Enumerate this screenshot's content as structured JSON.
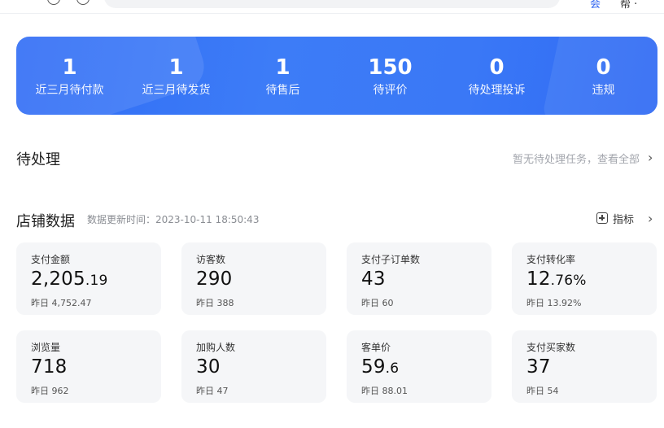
{
  "topbar": {
    "link_text": "会",
    "link_text2": "帮 ·"
  },
  "summary": [
    {
      "value": "1",
      "label": "近三月待付款"
    },
    {
      "value": "1",
      "label": "近三月待发货"
    },
    {
      "value": "1",
      "label": "待售后"
    },
    {
      "value": "150",
      "label": "待评价"
    },
    {
      "value": "0",
      "label": "待处理投诉"
    },
    {
      "value": "0",
      "label": "违规"
    }
  ],
  "pending": {
    "title": "待处理",
    "hint": "暂无待处理任务，查看全部"
  },
  "shop": {
    "title": "店铺数据",
    "update_time": "数据更新时间：2023-10-11 18:50:43",
    "metrics_label": "指标",
    "cards": [
      {
        "title": "支付金额",
        "int": "2,205",
        "dec": ".19",
        "prev": "昨日 4,752.47"
      },
      {
        "title": "访客数",
        "int": "290",
        "dec": "",
        "prev": "昨日 388"
      },
      {
        "title": "支付子订单数",
        "int": "43",
        "dec": "",
        "prev": "昨日 60"
      },
      {
        "title": "支付转化率",
        "int": "12",
        "dec": ".76%",
        "prev": "昨日 13.92%"
      },
      {
        "title": "浏览量",
        "int": "718",
        "dec": "",
        "prev": "昨日 962"
      },
      {
        "title": "加购人数",
        "int": "30",
        "dec": "",
        "prev": "昨日 47"
      },
      {
        "title": "客单价",
        "int": "59",
        "dec": ".6",
        "prev": "昨日 88.01"
      },
      {
        "title": "支付买家数",
        "int": "37",
        "dec": "",
        "prev": "昨日 54"
      }
    ]
  }
}
